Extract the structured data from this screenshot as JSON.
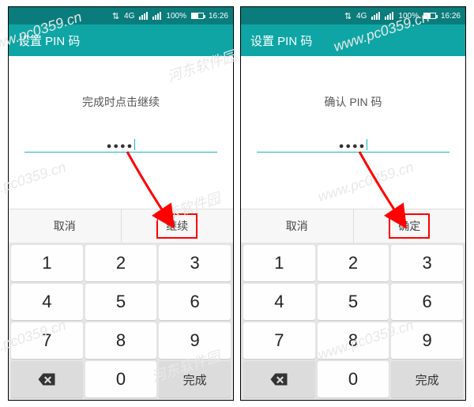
{
  "status": {
    "net_label": "4G",
    "battery_pct": "100%",
    "time": "16:26"
  },
  "header_title": "设置 PIN 码",
  "left_screen": {
    "instruction": "完成时点击继续",
    "pin_value": "●●●●",
    "cancel_label": "取消",
    "confirm_label": "继续"
  },
  "right_screen": {
    "instruction": "确认 PIN 码",
    "pin_value": "●●●●",
    "cancel_label": "取消",
    "confirm_label": "确定"
  },
  "keypad": {
    "keys": [
      "1",
      "2",
      "3",
      "4",
      "5",
      "6",
      "7",
      "8",
      "9"
    ],
    "zero": "0",
    "done_label": "完成"
  },
  "watermark_text": "河东软件园",
  "watermark_url": "www.pc0359.cn"
}
